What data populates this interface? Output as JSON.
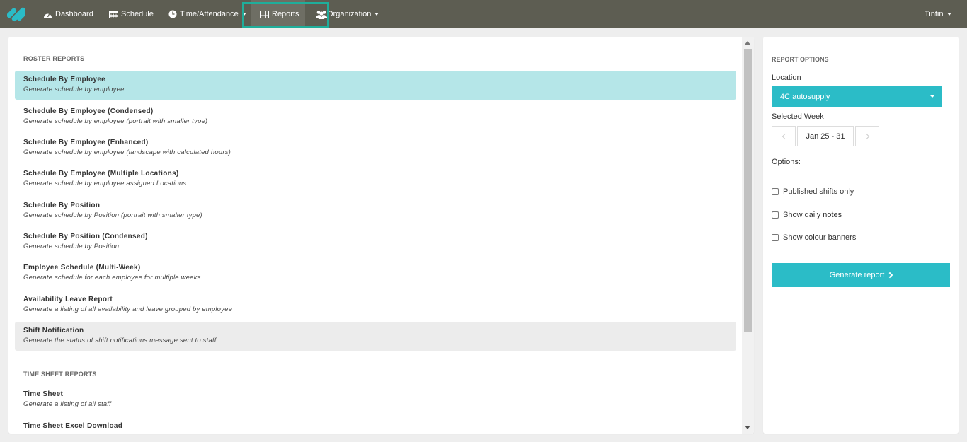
{
  "nav": {
    "dashboard": "Dashboard",
    "schedule": "Schedule",
    "time_attendance": "Time/Attendance",
    "reports": "Reports",
    "organization": "Organization",
    "user": "Tintin"
  },
  "roster": {
    "title": "ROSTER REPORTS",
    "items": [
      {
        "title": "Schedule By Employee",
        "desc": "Generate schedule by employee"
      },
      {
        "title": "Schedule By Employee (Condensed)",
        "desc": "Generate schedule by employee (portrait with smaller type)"
      },
      {
        "title": "Schedule By Employee (Enhanced)",
        "desc": "Generate schedule by employee (landscape with calculated hours)"
      },
      {
        "title": "Schedule By Employee (Multiple Locations)",
        "desc": "Generate schedule by employee assigned Locations"
      },
      {
        "title": "Schedule By Position",
        "desc": "Generate schedule by Position (portrait with smaller type)"
      },
      {
        "title": "Schedule By Position (Condensed)",
        "desc": "Generate schedule by Position"
      },
      {
        "title": "Employee Schedule (Multi-Week)",
        "desc": "Generate schedule for each employee for multiple weeks"
      },
      {
        "title": "Availability Leave Report",
        "desc": "Generate a listing of all availability and leave grouped by employee"
      },
      {
        "title": "Shift Notification",
        "desc": "Generate the status of shift notifications message sent to staff"
      }
    ]
  },
  "timesheet": {
    "title": "TIME SHEET REPORTS",
    "items": [
      {
        "title": "Time Sheet",
        "desc": "Generate a listing of all staff"
      },
      {
        "title": "Time Sheet Excel Download",
        "desc": ""
      }
    ]
  },
  "options": {
    "title": "REPORT OPTIONS",
    "location_label": "Location",
    "location_value": "4C autosupply",
    "week_label": "Selected Week",
    "week_value": "Jan 25 - 31",
    "options_label": "Options:",
    "checkboxes": [
      "Published shifts only",
      "Show daily notes",
      "Show colour banners"
    ],
    "generate": "Generate report"
  },
  "colors": {
    "nav_bg": "#5d5d52",
    "accent": "#2bbcc7",
    "selected_bg": "#b5e6e8",
    "highlight_border": "#1fae9b"
  }
}
